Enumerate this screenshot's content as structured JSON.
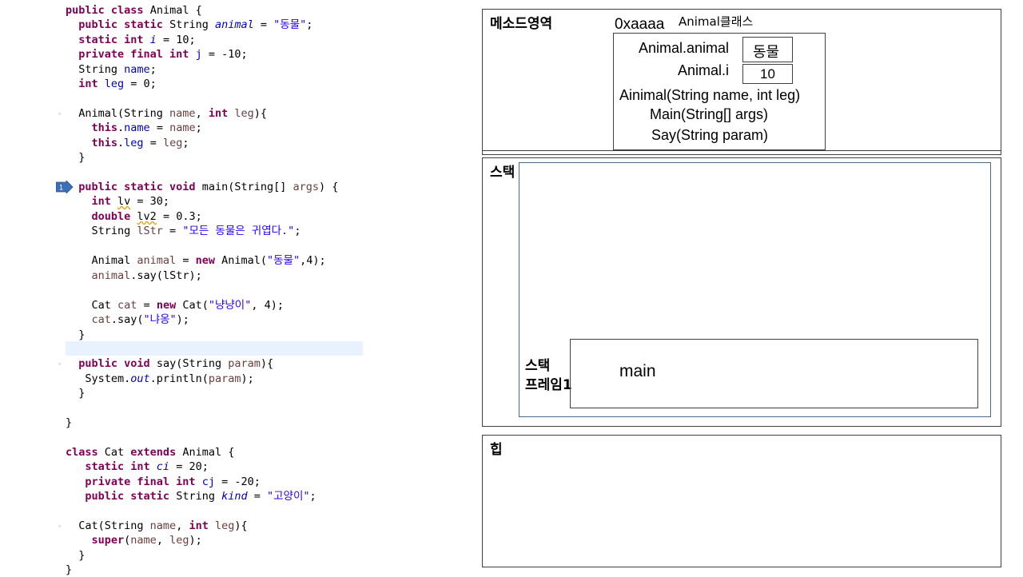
{
  "code": {
    "lines": [
      [
        [
          "kw",
          "public "
        ],
        [
          "kw",
          "class "
        ],
        [
          "",
          "Animal {"
        ]
      ],
      [
        [
          "",
          "  "
        ],
        [
          "kw",
          "public static "
        ],
        [
          "",
          "String "
        ],
        [
          "sfld",
          "animal"
        ],
        [
          "",
          ". = "
        ],
        [
          "str",
          "\"동물\""
        ],
        [
          "",
          ";"
        ]
      ],
      [
        [
          "",
          "  "
        ],
        [
          "kw",
          "static int "
        ],
        [
          "sfld",
          "i"
        ],
        [
          "",
          ". = 10;"
        ]
      ],
      [
        [
          "",
          "  "
        ],
        [
          "kw",
          "private final int "
        ],
        [
          "fld",
          "j"
        ],
        [
          "",
          ". = -10;"
        ]
      ],
      [
        [
          "",
          "  String "
        ],
        [
          "fld",
          "name"
        ],
        [
          "",
          ";"
        ]
      ],
      [
        [
          "",
          "  "
        ],
        [
          "kw",
          "int "
        ],
        [
          "fld",
          "leg"
        ],
        [
          "",
          ". = 0;"
        ]
      ],
      [],
      [
        [
          "",
          "  Animal(String "
        ],
        [
          "var",
          "name"
        ],
        [
          "",
          ", "
        ],
        [
          "kw",
          "int "
        ],
        [
          "var",
          "leg"
        ],
        [
          "",
          "){"
        ]
      ],
      [
        [
          "",
          "    "
        ],
        [
          "kw",
          "this"
        ],
        [
          "",
          "."
        ],
        [
          "fld",
          "name"
        ],
        [
          "",
          ". = "
        ],
        [
          "var",
          "name"
        ],
        [
          "",
          ";"
        ]
      ],
      [
        [
          "",
          "    "
        ],
        [
          "kw",
          "this"
        ],
        [
          "",
          "."
        ],
        [
          "fld",
          "leg"
        ],
        [
          "",
          ". = "
        ],
        [
          "var",
          "leg"
        ],
        [
          "",
          ";"
        ]
      ],
      [
        [
          "",
          "  }"
        ]
      ],
      [],
      [
        [
          "",
          "  "
        ],
        [
          "kw",
          "public static void "
        ],
        [
          "",
          "main(String[] "
        ],
        [
          "var",
          "args"
        ],
        [
          "",
          ") {"
        ]
      ],
      [
        [
          "",
          "    "
        ],
        [
          "kw",
          "int "
        ],
        [
          "warn",
          "lv"
        ],
        [
          "",
          ". = 30;"
        ]
      ],
      [
        [
          "",
          "    "
        ],
        [
          "kw",
          "double "
        ],
        [
          "warn",
          "lv2"
        ],
        [
          "",
          ". = 0.3;"
        ]
      ],
      [
        [
          "",
          "    String "
        ],
        [
          "var",
          "lStr"
        ],
        [
          "",
          ". = "
        ],
        [
          "str",
          "\"모든 동물은 귀엽다.\""
        ],
        [
          "",
          ";"
        ]
      ],
      [],
      [
        [
          "",
          "    Animal "
        ],
        [
          "var",
          "animal"
        ],
        [
          "",
          ". = "
        ],
        [
          "kw",
          "new "
        ],
        [
          "",
          "Animal("
        ],
        [
          "str",
          "\"동물\""
        ],
        [
          "",
          ",4);"
        ]
      ],
      [
        [
          "",
          "    "
        ],
        [
          "var",
          "animal"
        ],
        [
          "",
          ".say(lStr);"
        ]
      ],
      [],
      [
        [
          "",
          "    Cat "
        ],
        [
          "var",
          "cat"
        ],
        [
          "",
          ". = "
        ],
        [
          "kw",
          "new "
        ],
        [
          "",
          "Cat("
        ],
        [
          "str",
          "\"냥냥이\""
        ],
        [
          "",
          ", 4);"
        ]
      ],
      [
        [
          "",
          "    "
        ],
        [
          "var",
          "cat"
        ],
        [
          "",
          ".say("
        ],
        [
          "str",
          "\"냐옹\""
        ],
        [
          "",
          ");"
        ]
      ],
      [
        [
          "",
          "  }"
        ]
      ],
      [],
      [
        [
          "",
          "  "
        ],
        [
          "kw",
          "public void "
        ],
        [
          "",
          "say(String "
        ],
        [
          "var",
          "param"
        ],
        [
          "",
          "){"
        ]
      ],
      [
        [
          "",
          "   System."
        ],
        [
          "sfld",
          "out"
        ],
        [
          "",
          ".println("
        ],
        [
          "var",
          "param"
        ],
        [
          "",
          ");"
        ]
      ],
      [
        [
          "",
          "  }"
        ]
      ],
      [],
      [
        [
          "",
          "}"
        ]
      ],
      [],
      [
        [
          "kw",
          "class "
        ],
        [
          "",
          "Cat "
        ],
        [
          "kw",
          "extends "
        ],
        [
          "",
          "Animal {"
        ]
      ],
      [
        [
          "",
          "   "
        ],
        [
          "kw",
          "static int "
        ],
        [
          "sfld",
          "ci"
        ],
        [
          "",
          ". = 20;"
        ]
      ],
      [
        [
          "",
          "   "
        ],
        [
          "kw",
          "private final int "
        ],
        [
          "fld",
          "cj"
        ],
        [
          "",
          ". = -20;"
        ]
      ],
      [
        [
          "",
          "   "
        ],
        [
          "kw",
          "public static "
        ],
        [
          "",
          "String "
        ],
        [
          "sfld",
          "kind"
        ],
        [
          "",
          ". = "
        ],
        [
          "str",
          "\"고양이\""
        ],
        [
          "",
          ";"
        ]
      ],
      [],
      [
        [
          "",
          "  Cat(String "
        ],
        [
          "var",
          "name"
        ],
        [
          "",
          ", "
        ],
        [
          "kw",
          "int "
        ],
        [
          "var",
          "leg"
        ],
        [
          "",
          "){"
        ]
      ],
      [
        [
          "",
          "    "
        ],
        [
          "kw",
          "super"
        ],
        [
          "",
          "("
        ],
        [
          "var",
          "name"
        ],
        [
          "",
          ", "
        ],
        [
          "var",
          "leg"
        ],
        [
          "",
          ");"
        ]
      ],
      [
        [
          "",
          "  }"
        ]
      ],
      [
        [
          "",
          "}"
        ]
      ]
    ],
    "breakpoint_label": "1"
  },
  "memory": {
    "method_area_title": "메소드영역",
    "address": "0xaaaa",
    "class_label": "Animal클래스",
    "static_animal_name": "Animal.animal",
    "static_animal_value": "동물",
    "static_i_name": "Animal.i",
    "static_i_value": "10",
    "constructor": "Ainimal(String name, int leg)",
    "main_method": "Main(String[] args)",
    "say_method": "Say(String param)",
    "stack_title": "스택",
    "stack_frame_label_line1": "스택",
    "stack_frame_label_line2": "프레임1",
    "frame_name": "main",
    "heap_title": "힙"
  }
}
